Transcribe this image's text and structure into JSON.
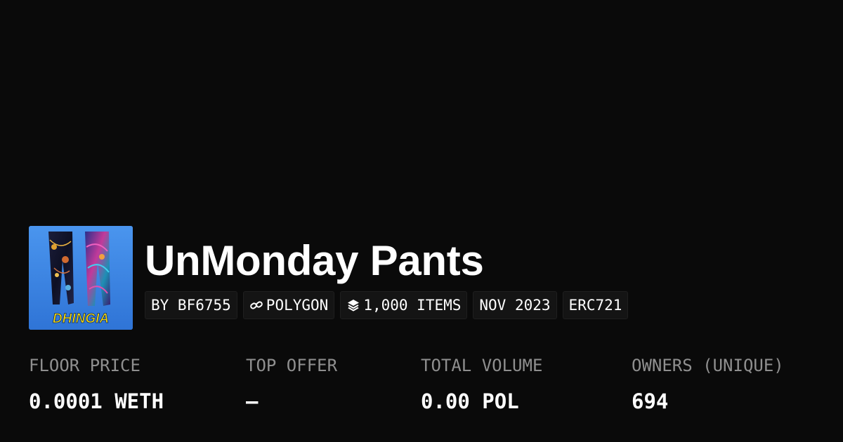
{
  "collection": {
    "title": "UnMonday Pants",
    "avatar_logo_text": "DHINGIA",
    "avatar_icon": "pants-artwork-image"
  },
  "pills": [
    {
      "label": "BY BF6755",
      "icon": null
    },
    {
      "label": "POLYGON",
      "icon": "chain-link-icon"
    },
    {
      "label": "1,000 ITEMS",
      "icon": "layers-icon"
    },
    {
      "label": "NOV 2023",
      "icon": null
    },
    {
      "label": "ERC721",
      "icon": null
    }
  ],
  "stats": [
    {
      "label": "FLOOR PRICE",
      "value": "0.0001 WETH"
    },
    {
      "label": "TOP OFFER",
      "value": "–"
    },
    {
      "label": "TOTAL VOLUME",
      "value": "0.00 POL"
    },
    {
      "label": "OWNERS (UNIQUE)",
      "value": "694"
    }
  ],
  "colors": {
    "background": "#0a0a0a",
    "pill_background": "#141414",
    "label_gray": "#8f8f8f",
    "avatar_blue": "#3a86e6",
    "logo_yellow": "#f5d90a"
  }
}
